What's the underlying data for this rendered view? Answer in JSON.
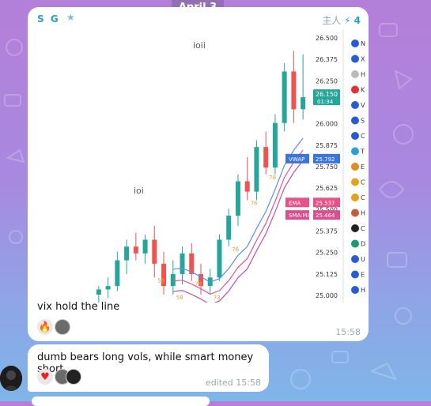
{
  "date_label": "April 3",
  "message1": {
    "sender": "S G",
    "admin_title": "主人",
    "boost_count": "4",
    "text": "vix hold the line",
    "time": "15:58",
    "reactions": [
      "fire",
      "avatar"
    ]
  },
  "message2": {
    "text": "dumb bears long vols, while smart money short",
    "time": "edited 15:58",
    "reactions": [
      "heart",
      "avatar",
      "avatar"
    ]
  },
  "chart_overlay": {
    "labels_top": [
      "ioii",
      "ioi"
    ],
    "price_box": "26.150",
    "timer": "01:34",
    "vwap_label": "VWAP",
    "vwap_value": "25.792",
    "ema_label": "EMA",
    "ema_value": "25.537",
    "sma_label": "SMA:MA",
    "sma_value": "25.464",
    "side_letters": [
      "N",
      "X",
      "H",
      "K",
      "V",
      "S",
      "C",
      "T",
      "E",
      "C",
      "C",
      "H",
      "C",
      "D",
      "U",
      "E",
      "H"
    ]
  },
  "chart_data": {
    "type": "candlestick",
    "y_ticks": [
      "26.500",
      "26.375",
      "26.250",
      "26.125",
      "26.000",
      "25.875",
      "25.750",
      "25.625",
      "25.500",
      "25.375",
      "25.250",
      "25.125",
      "25.000"
    ],
    "ylim": [
      25.0,
      26.5
    ],
    "candles": [
      {
        "o": 25.0,
        "h": 25.05,
        "l": 24.95,
        "c": 25.03,
        "dir": "up"
      },
      {
        "o": 25.03,
        "h": 25.1,
        "l": 24.98,
        "c": 25.05,
        "dir": "up"
      },
      {
        "o": 25.05,
        "h": 25.25,
        "l": 25.02,
        "c": 25.2,
        "dir": "up"
      },
      {
        "o": 25.2,
        "h": 25.32,
        "l": 25.12,
        "c": 25.28,
        "dir": "up"
      },
      {
        "o": 25.28,
        "h": 25.36,
        "l": 25.2,
        "c": 25.24,
        "dir": "down"
      },
      {
        "o": 25.24,
        "h": 25.35,
        "l": 25.18,
        "c": 25.32,
        "dir": "up"
      },
      {
        "o": 25.32,
        "h": 25.4,
        "l": 25.1,
        "c": 25.18,
        "dir": "down"
      },
      {
        "o": 25.18,
        "h": 25.25,
        "l": 25.0,
        "c": 25.05,
        "dir": "down"
      },
      {
        "o": 25.05,
        "h": 25.2,
        "l": 25.0,
        "c": 25.12,
        "dir": "up"
      },
      {
        "o": 25.12,
        "h": 25.28,
        "l": 25.06,
        "c": 25.24,
        "dir": "up"
      },
      {
        "o": 25.24,
        "h": 25.3,
        "l": 25.08,
        "c": 25.12,
        "dir": "down"
      },
      {
        "o": 25.12,
        "h": 25.18,
        "l": 25.0,
        "c": 25.05,
        "dir": "down"
      },
      {
        "o": 25.05,
        "h": 25.15,
        "l": 25.0,
        "c": 25.1,
        "dir": "up"
      },
      {
        "o": 25.1,
        "h": 25.35,
        "l": 25.08,
        "c": 25.32,
        "dir": "up"
      },
      {
        "o": 25.32,
        "h": 25.5,
        "l": 25.28,
        "c": 25.46,
        "dir": "up"
      },
      {
        "o": 25.46,
        "h": 25.7,
        "l": 25.4,
        "c": 25.66,
        "dir": "up"
      },
      {
        "o": 25.66,
        "h": 25.8,
        "l": 25.55,
        "c": 25.6,
        "dir": "down"
      },
      {
        "o": 25.6,
        "h": 25.9,
        "l": 25.55,
        "c": 25.86,
        "dir": "up"
      },
      {
        "o": 25.86,
        "h": 25.95,
        "l": 25.7,
        "c": 25.74,
        "dir": "down"
      },
      {
        "o": 25.74,
        "h": 26.05,
        "l": 25.7,
        "c": 26.0,
        "dir": "up"
      },
      {
        "o": 26.0,
        "h": 26.35,
        "l": 25.95,
        "c": 26.3,
        "dir": "up"
      },
      {
        "o": 26.3,
        "h": 26.42,
        "l": 26.0,
        "c": 26.08,
        "dir": "down"
      },
      {
        "o": 26.08,
        "h": 26.4,
        "l": 26.02,
        "c": 26.15,
        "dir": "up"
      }
    ],
    "candle_labels": [
      "58",
      "58",
      "78",
      "73",
      "76",
      "76",
      "78"
    ]
  }
}
